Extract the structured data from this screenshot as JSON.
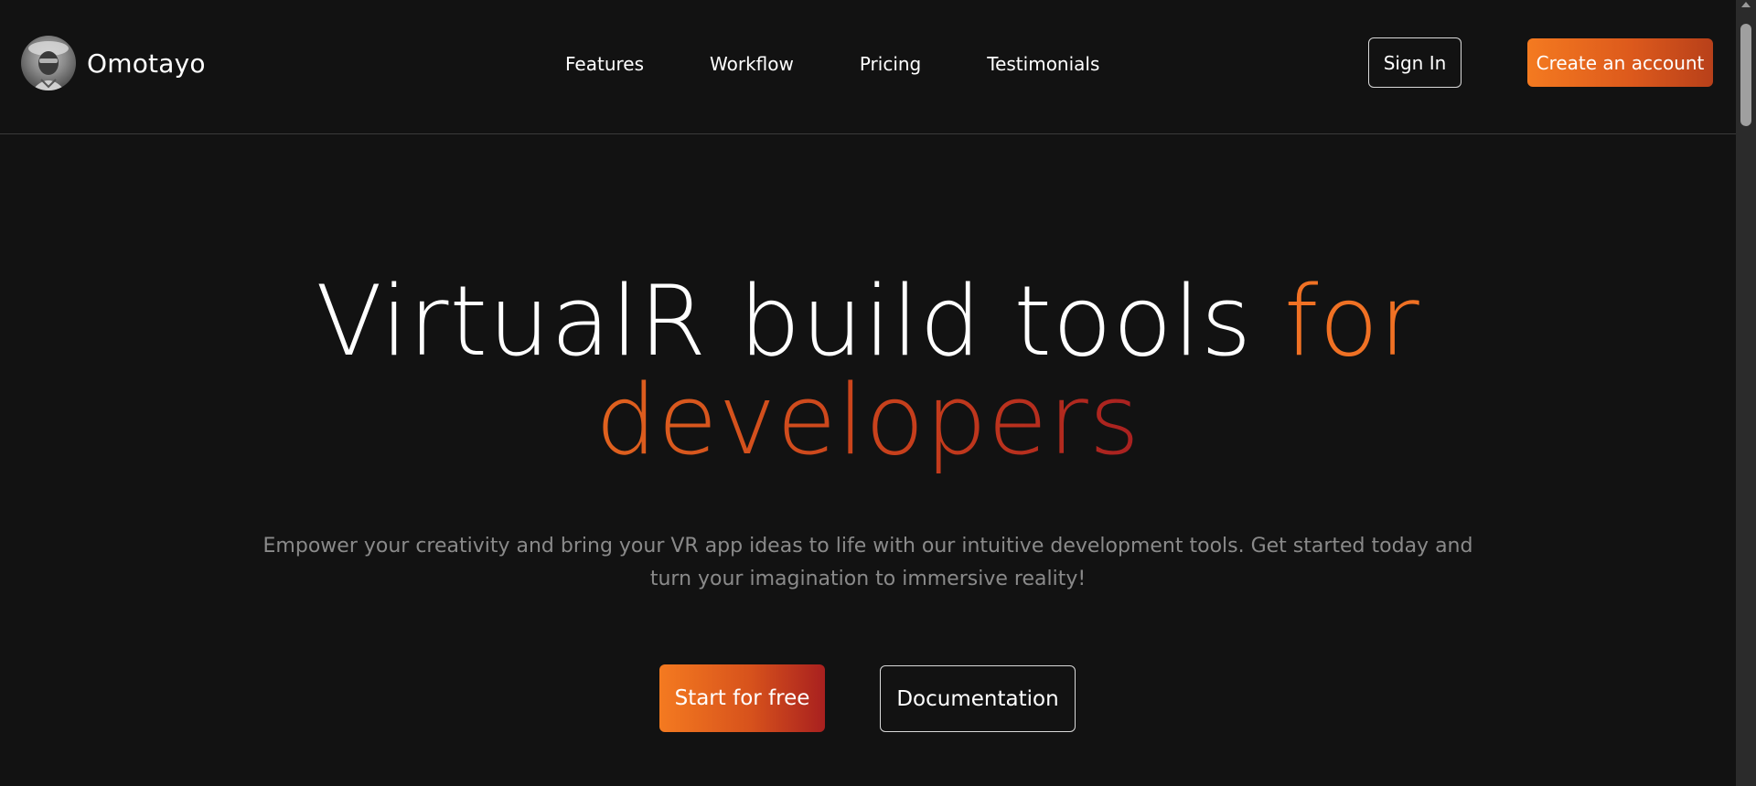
{
  "brand": {
    "name": "Omotayo",
    "avatar_icon": "profile-photo"
  },
  "nav": {
    "items": [
      {
        "label": "Features"
      },
      {
        "label": "Workflow"
      },
      {
        "label": "Pricing"
      },
      {
        "label": "Testimonials"
      }
    ]
  },
  "header_actions": {
    "sign_in_label": "Sign In",
    "create_account_label": "Create an account"
  },
  "hero": {
    "title_part1": "VirtualR build tools",
    "title_accent1": "for",
    "title_accent2": "developers",
    "subtitle": "Empower your creativity and bring your VR app ideas to life with our intuitive development tools. Get started today and turn your imagination to immersive reality!",
    "primary_cta": "Start for free",
    "secondary_cta": "Documentation"
  },
  "colors": {
    "background": "#121212",
    "accent_orange": "#f47a20",
    "accent_red": "#a8201f",
    "muted_text": "#8a8a8a"
  }
}
